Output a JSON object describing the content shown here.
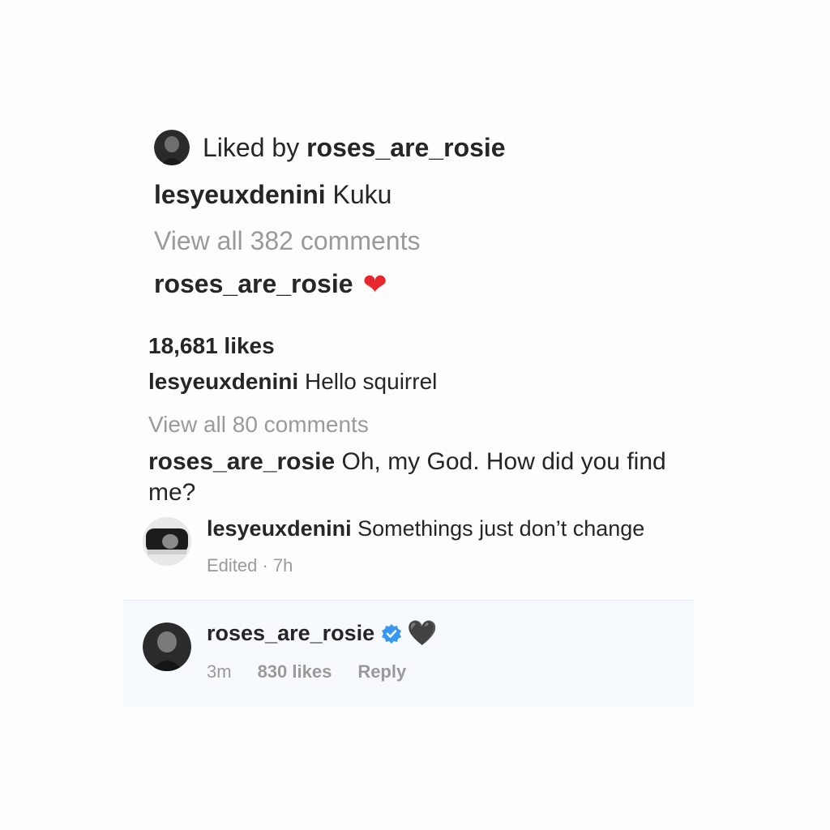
{
  "post1": {
    "liked_by_prefix": "Liked by ",
    "liked_by_user": "roses_are_rosie",
    "caption_user": "lesyeuxdenini",
    "caption_text": " Kuku",
    "view_all": "View all 382 comments",
    "comment_user": "roses_are_rosie",
    "comment_emoji": "❤"
  },
  "post2": {
    "likes": "18,681 likes",
    "caption_user": "lesyeuxdenini",
    "caption_text": " Hello squirrel",
    "view_all": "View all 80 comments",
    "comment_user": "roses_are_rosie",
    "comment_text": " Oh, my God. How did you find me?"
  },
  "reply1": {
    "user": "lesyeuxdenini",
    "text": " Somethings just don’t change",
    "meta": "Edited · 7h"
  },
  "reply2": {
    "user": "roses_are_rosie",
    "emoji": "🖤",
    "time": "3m",
    "likes": "830 likes",
    "reply_label": "Reply"
  },
  "colors": {
    "text": "#262626",
    "secondary": "#9a9a9a",
    "verified": "#3897f0",
    "highlight_bg": "#f6f9fd",
    "heart_red": "#e8262b"
  },
  "icons": {
    "verified": "verified-badge-icon",
    "red_heart": "red-heart-icon",
    "black_heart": "black-heart-icon"
  }
}
